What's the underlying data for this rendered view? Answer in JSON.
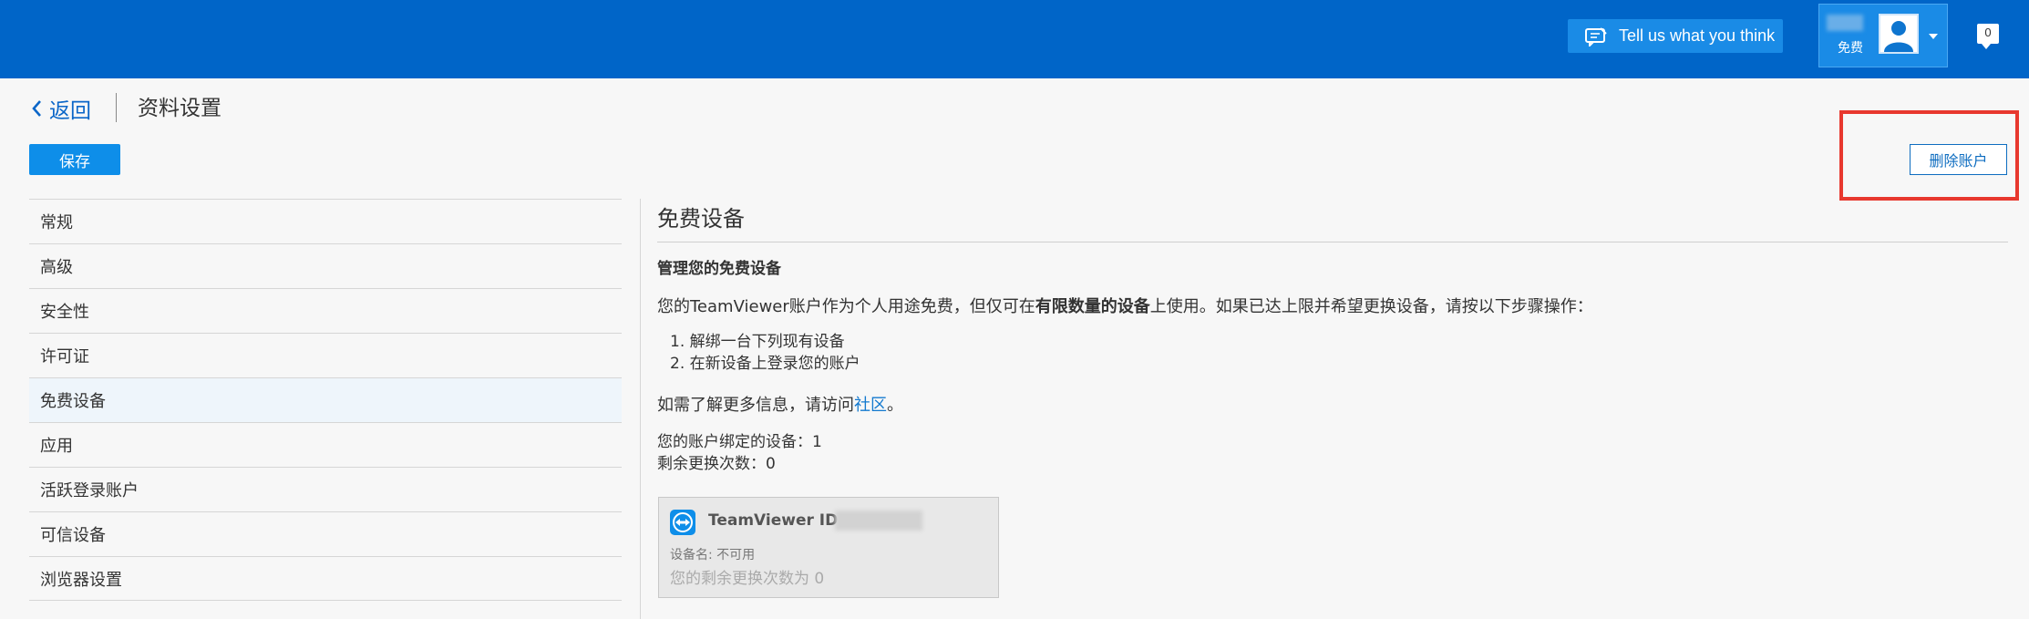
{
  "topbar": {
    "feedback_label": "Tell us what you think",
    "account_plan": "免费",
    "notification_count": "0",
    "brand_color": "#0065c8"
  },
  "header": {
    "back_label": "返回",
    "title": "资料设置",
    "save_label": "保存",
    "delete_account_label": "删除账户"
  },
  "sidebar": {
    "items": [
      {
        "label": "常规"
      },
      {
        "label": "高级"
      },
      {
        "label": "安全性"
      },
      {
        "label": "许可证"
      },
      {
        "label": "免费设备"
      },
      {
        "label": "应用"
      },
      {
        "label": "活跃登录账户"
      },
      {
        "label": "可信设备"
      },
      {
        "label": "浏览器设置"
      }
    ],
    "active_index": 4
  },
  "main": {
    "section_title": "免费设备",
    "subheading": "管理您的免费设备",
    "desc_pre": "您的TeamViewer账户作为个人用途免费，但仅可在",
    "desc_bold": "有限数量的设备",
    "desc_post": "上使用。如果已达上限并希望更换设备，请按以下步骤操作：",
    "steps": [
      "1. 解绑一台下列现有设备",
      "2. 在新设备上登录您的账户"
    ],
    "more_info_pre": "如需了解更多信息，请访问",
    "more_info_link": "社区",
    "more_info_post": "。",
    "bound_devices": "您的账户绑定的设备：1",
    "remaining_swaps": "剩余更换次数：0",
    "device_card": {
      "id_label": "TeamViewer ID: ",
      "device_name": "设备名: 不可用",
      "remaining_text": "您的剩余更换次数为 0"
    }
  },
  "icons": {
    "feedback": "feedback-icon",
    "avatar": "user-avatar-icon",
    "notification": "notification-icon",
    "back": "chevron-left-icon",
    "teamviewer": "teamviewer-logo-icon"
  }
}
